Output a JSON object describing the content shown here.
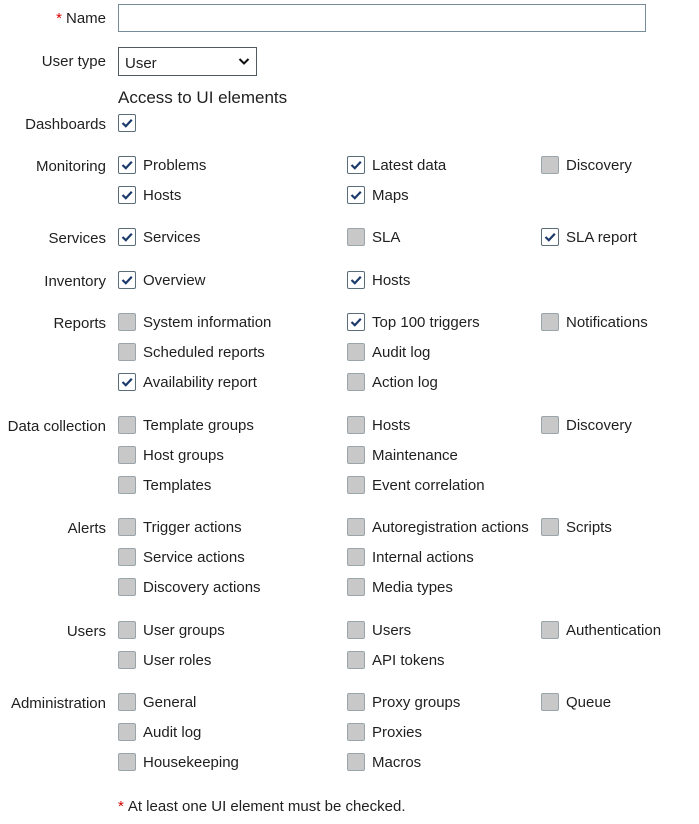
{
  "form": {
    "name_label": "Name",
    "required_mark": "*",
    "name_value": "",
    "user_type_label": "User type",
    "user_type_value": "User",
    "section_title": "Access to UI elements",
    "note": "At least one UI element must be checked."
  },
  "groups": [
    {
      "label": "Dashboards",
      "items": [
        {
          "label": "",
          "checked": true
        }
      ]
    },
    {
      "label": "Monitoring",
      "items": [
        {
          "label": "Problems",
          "checked": true
        },
        {
          "label": "Latest data",
          "checked": true
        },
        {
          "label": "Discovery",
          "checked": false
        },
        {
          "label": "Hosts",
          "checked": true
        },
        {
          "label": "Maps",
          "checked": true
        }
      ]
    },
    {
      "label": "Services",
      "items": [
        {
          "label": "Services",
          "checked": true
        },
        {
          "label": "SLA",
          "checked": false
        },
        {
          "label": "SLA report",
          "checked": true
        }
      ]
    },
    {
      "label": "Inventory",
      "items": [
        {
          "label": "Overview",
          "checked": true
        },
        {
          "label": "Hosts",
          "checked": true
        }
      ]
    },
    {
      "label": "Reports",
      "items": [
        {
          "label": "System information",
          "checked": false
        },
        {
          "label": "Top 100 triggers",
          "checked": true
        },
        {
          "label": "Notifications",
          "checked": false
        },
        {
          "label": "Scheduled reports",
          "checked": false
        },
        {
          "label": "Audit log",
          "checked": false
        },
        null,
        {
          "label": "Availability report",
          "checked": true
        },
        {
          "label": "Action log",
          "checked": false
        }
      ]
    },
    {
      "label": "Data collection",
      "items": [
        {
          "label": "Template groups",
          "checked": false
        },
        {
          "label": "Hosts",
          "checked": false
        },
        {
          "label": "Discovery",
          "checked": false
        },
        {
          "label": "Host groups",
          "checked": false
        },
        {
          "label": "Maintenance",
          "checked": false
        },
        null,
        {
          "label": "Templates",
          "checked": false
        },
        {
          "label": "Event correlation",
          "checked": false
        }
      ]
    },
    {
      "label": "Alerts",
      "items": [
        {
          "label": "Trigger actions",
          "checked": false
        },
        {
          "label": "Autoregistration actions",
          "checked": false
        },
        {
          "label": "Scripts",
          "checked": false
        },
        {
          "label": "Service actions",
          "checked": false
        },
        {
          "label": "Internal actions",
          "checked": false
        },
        null,
        {
          "label": "Discovery actions",
          "checked": false
        },
        {
          "label": "Media types",
          "checked": false
        }
      ]
    },
    {
      "label": "Users",
      "items": [
        {
          "label": "User groups",
          "checked": false
        },
        {
          "label": "Users",
          "checked": false
        },
        {
          "label": "Authentication",
          "checked": false
        },
        {
          "label": "User roles",
          "checked": false
        },
        {
          "label": "API tokens",
          "checked": false
        }
      ]
    },
    {
      "label": "Administration",
      "items": [
        {
          "label": "General",
          "checked": false
        },
        {
          "label": "Proxy groups",
          "checked": false
        },
        {
          "label": "Queue",
          "checked": false
        },
        {
          "label": "Audit log",
          "checked": false
        },
        {
          "label": "Proxies",
          "checked": false
        },
        null,
        {
          "label": "Housekeeping",
          "checked": false
        },
        {
          "label": "Macros",
          "checked": false
        }
      ]
    }
  ]
}
